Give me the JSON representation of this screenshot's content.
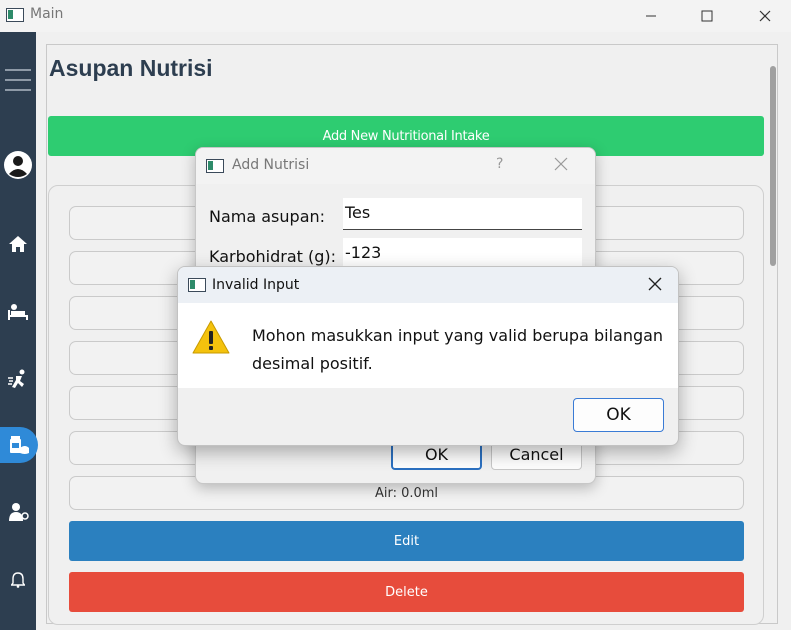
{
  "window": {
    "title": "Main"
  },
  "page": {
    "title": "Asupan Nutrisi",
    "add_button_label": "Add New Nutritional Intake",
    "rows": [
      "",
      "",
      "",
      "",
      "",
      "",
      "Air: 0.0ml"
    ],
    "edit_label": "Edit",
    "delete_label": "Delete"
  },
  "add_dialog": {
    "title": "Add Nutrisi",
    "help": "?",
    "fields": [
      {
        "label": "Nama asupan:",
        "value": "Tes"
      },
      {
        "label": "Karbohidrat (g):",
        "value": "-123"
      }
    ],
    "ok_label": "OK",
    "cancel_label": "Cancel"
  },
  "alert": {
    "title": "Invalid Input",
    "message": "Mohon masukkan input yang valid berupa bilangan desimal positif.",
    "ok_label": "OK",
    "icon": "warning-icon"
  },
  "colors": {
    "sidebar": "#2d3e50",
    "add": "#2ecc71",
    "edit": "#2b80bf",
    "delete": "#e74c3c",
    "active_nav": "#2f8ad8"
  }
}
